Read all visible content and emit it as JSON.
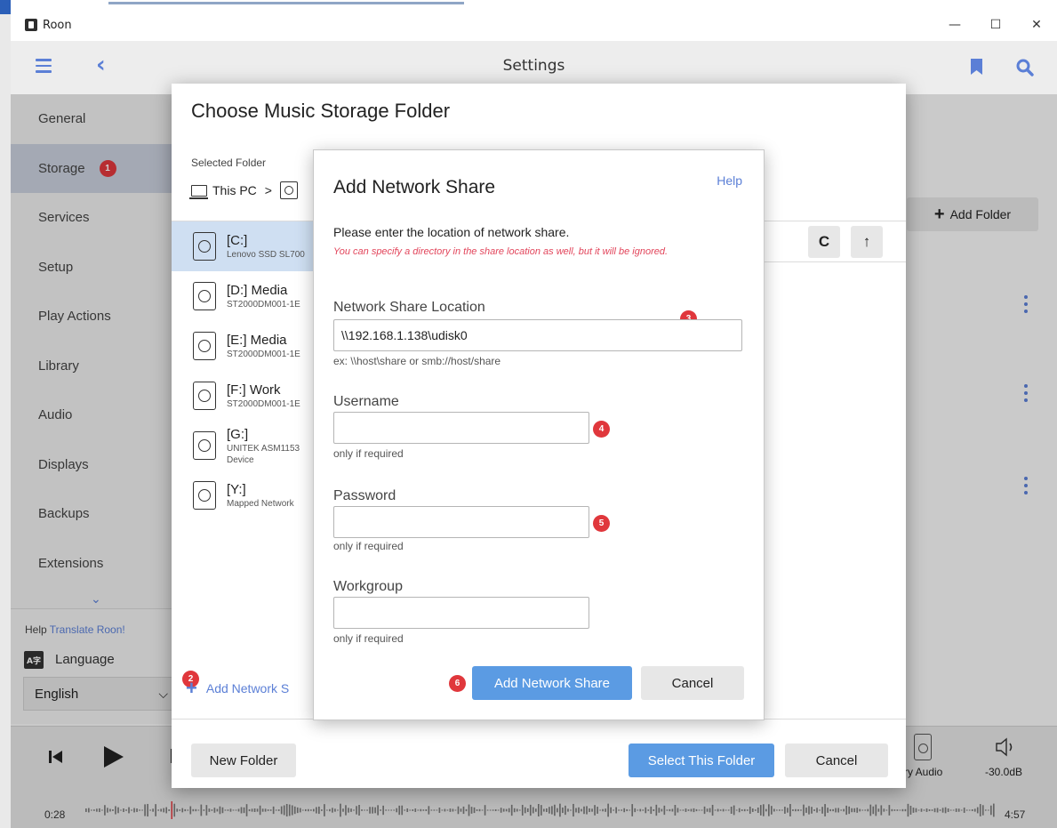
{
  "window": {
    "title": "Roon",
    "minimize": "—",
    "maximize": "☐",
    "close": "✕"
  },
  "header": {
    "title": "Settings"
  },
  "sidebar": {
    "items": [
      {
        "label": "General"
      },
      {
        "label": "Storage",
        "badge": "1"
      },
      {
        "label": "Services"
      },
      {
        "label": "Setup"
      },
      {
        "label": "Play Actions"
      },
      {
        "label": "Library"
      },
      {
        "label": "Audio"
      },
      {
        "label": "Displays"
      },
      {
        "label": "Backups"
      },
      {
        "label": "Extensions"
      }
    ],
    "help_prefix": "Help ",
    "help_link": "Translate Roon!",
    "language_icon": "A字",
    "language_label": "Language",
    "language_value": "English"
  },
  "main": {
    "add_folder": "Add Folder"
  },
  "player": {
    "elapsed": "0:28",
    "total": "4:57",
    "zone": "ry Audio",
    "volume": "-30.0dB"
  },
  "folder_dialog": {
    "title": "Choose Music Storage Folder",
    "selected_label": "Selected Folder",
    "crumb_root": "This PC",
    "crumb_sep": ">",
    "drives": [
      {
        "name": "[C:]",
        "sub": "Lenovo SSD SL700",
        "selected": true
      },
      {
        "name": "[D:] Media",
        "sub": "ST2000DM001-1E"
      },
      {
        "name": "[E:] Media",
        "sub": "ST2000DM001-1E"
      },
      {
        "name": "[F:] Work",
        "sub": "ST2000DM001-1E"
      },
      {
        "name": "[G:]",
        "sub": "UNITEK ASM1153",
        "sub2": "Device"
      },
      {
        "name": "[Y:]",
        "sub": "Mapped Network"
      }
    ],
    "refresh_glyph": "C",
    "up_glyph": "↑",
    "add_share": "Add Network S",
    "add_share_badge": "2",
    "new_folder": "New Folder",
    "select_folder": "Select This Folder",
    "cancel": "Cancel"
  },
  "share_dialog": {
    "title": "Add Network Share",
    "help": "Help",
    "intro": "Please enter the location of network share.",
    "note": "You can specify a directory in the share location as well, but it will be ignored.",
    "location": {
      "label": "Network Share Location",
      "value": "\\\\192.168.1.138\\udisk0",
      "hint": "ex: \\\\host\\share or smb://host/share",
      "badge": "3"
    },
    "username": {
      "label": "Username",
      "value": "",
      "hint": "only if required",
      "badge": "4"
    },
    "password": {
      "label": "Password",
      "value": "",
      "hint": "only if required",
      "badge": "5"
    },
    "workgroup": {
      "label": "Workgroup",
      "value": "",
      "hint": "only if required"
    },
    "add_button": "Add Network Share",
    "add_badge": "6",
    "cancel": "Cancel"
  },
  "colors": {
    "accent": "#5b7fd6",
    "primary_button": "#5b9be3",
    "badge": "#e0373c",
    "note": "#e2455b",
    "selected_row": "#cfdff2"
  }
}
